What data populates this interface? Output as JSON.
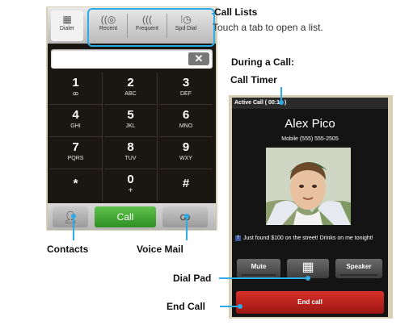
{
  "callouts": {
    "call_lists_title": "Call Lists",
    "call_lists_desc": "Touch a tab to open a list.",
    "during_call_title": "During a Call:",
    "call_timer": "Call Timer",
    "contacts": "Contacts",
    "voice_mail": "Voice Mail",
    "dial_pad": "Dial Pad",
    "end_call": "End Call"
  },
  "dialer": {
    "tabs": [
      {
        "label": "Dialer",
        "icon": "grid-icon"
      },
      {
        "label": "Recent",
        "icon": "recent-calls-icon"
      },
      {
        "label": "Frequent",
        "icon": "frequent-calls-icon"
      },
      {
        "label": "Spd Dial",
        "icon": "speed-dial-icon"
      }
    ],
    "entry_value": "",
    "delete_glyph": "✕",
    "keys": [
      {
        "num": "1",
        "letters": "ꝏ"
      },
      {
        "num": "2",
        "letters": "ABC"
      },
      {
        "num": "3",
        "letters": "DEF"
      },
      {
        "num": "4",
        "letters": "GHI"
      },
      {
        "num": "5",
        "letters": "JKL"
      },
      {
        "num": "6",
        "letters": "MNO"
      },
      {
        "num": "7",
        "letters": "PQRS"
      },
      {
        "num": "8",
        "letters": "TUV"
      },
      {
        "num": "9",
        "letters": "WXY"
      },
      {
        "num": "*",
        "letters": ""
      },
      {
        "num": "0",
        "letters": "+"
      },
      {
        "num": "#",
        "letters": ""
      }
    ],
    "call_label": "Call"
  },
  "active_call": {
    "title": "Active Call ( 00:12 )",
    "caller_name": "Alex Pico",
    "caller_number": "Mobile (555) 555-2505",
    "status_update": "Just found $100 on the street! Drinks on me tonight!",
    "mute_label": "Mute",
    "speaker_label": "Speaker",
    "end_call_label": "End call"
  },
  "colors": {
    "accent": "#2cabe6",
    "call_green": "#3aa72e",
    "end_call_red": "#c0231d",
    "screen_dark": "#1a1611"
  }
}
